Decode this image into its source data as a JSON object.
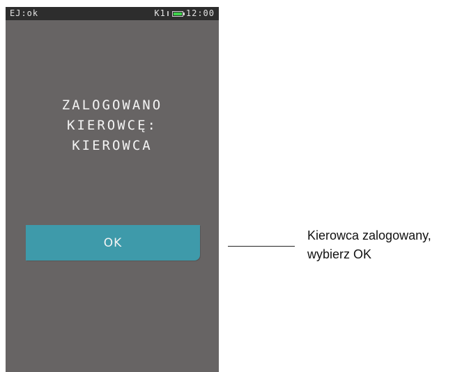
{
  "status_bar": {
    "left_text": "EJ:ok",
    "channel": "K1",
    "time": "12:00",
    "signal_icon": "signal-icon",
    "battery_icon": "battery-icon",
    "battery_color": "#3dd24a"
  },
  "screen": {
    "background_color": "#676464",
    "message_lines": [
      "ZALOGOWANO",
      "KIEROWCĘ:",
      "KIEROWCA"
    ],
    "ok_button_label": "OK",
    "ok_button_color": "#3e9aaa"
  },
  "callout": {
    "line1": "Kierowca zalogowany,",
    "line2": "wybierz OK"
  }
}
